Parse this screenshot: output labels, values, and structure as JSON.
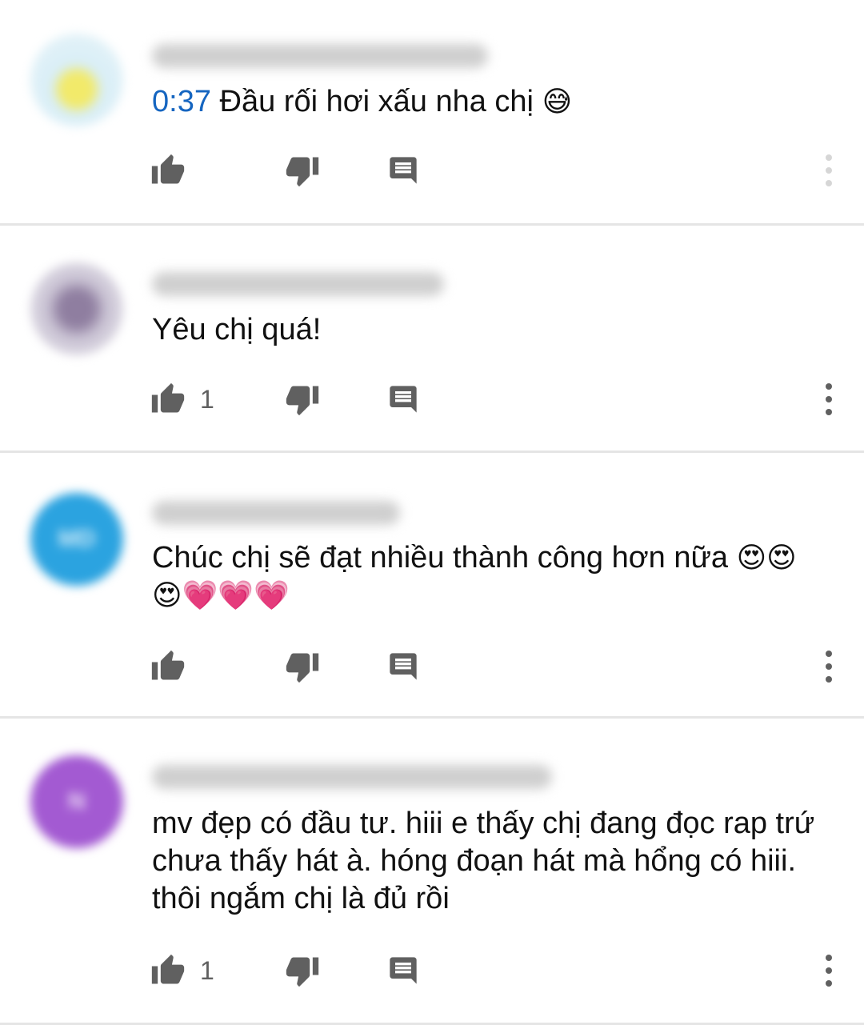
{
  "comments": [
    {
      "timestamp": "0:37",
      "text": " Đầu rối hơi xấu nha chị ",
      "emoji": "😅",
      "like_count": "",
      "icons": {
        "like": "thumb-up-icon",
        "dislike": "thumb-down-icon",
        "reply": "reply-comment-icon",
        "more": "more-vertical-icon"
      }
    },
    {
      "timestamp": "",
      "text": "Yêu chị quá!",
      "emoji": "",
      "like_count": "1",
      "icons": {
        "like": "thumb-up-icon",
        "dislike": "thumb-down-icon",
        "reply": "reply-comment-icon",
        "more": "more-vertical-icon"
      }
    },
    {
      "timestamp": "",
      "text": "Chúc chị sẽ đạt nhiều thành công hơn nữa ",
      "emoji": "😍😍😍💗💗💗",
      "like_count": "",
      "icons": {
        "like": "thumb-up-icon",
        "dislike": "thumb-down-icon",
        "reply": "reply-comment-icon",
        "more": "more-vertical-icon"
      }
    },
    {
      "timestamp": "",
      "text": "mv đẹp có đầu tư. hiii e thấy chị đang đọc rap trứ chưa thấy hát à. hóng đoạn hát mà hổng có hiii. thôi ngắm chị là đủ rồi",
      "emoji": "",
      "like_count": "1",
      "icons": {
        "like": "thumb-up-icon",
        "dislike": "thumb-down-icon",
        "reply": "reply-comment-icon",
        "more": "more-vertical-icon"
      }
    }
  ],
  "colors": {
    "timestamp_link": "#1565c0",
    "avatar_3": "#2ba3e0",
    "avatar_4": "#a35ad2",
    "divider": "#e5e5e5"
  }
}
